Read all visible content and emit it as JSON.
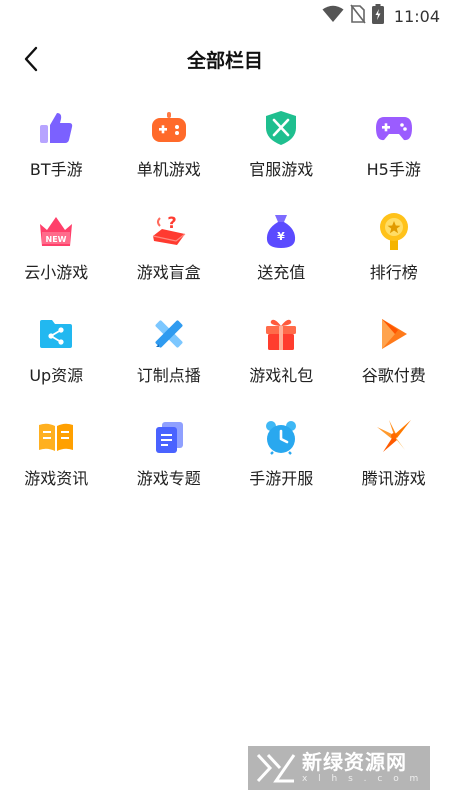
{
  "status_bar": {
    "time": "11:04"
  },
  "header": {
    "title": "全部栏目"
  },
  "categories": [
    {
      "label": "BT手游",
      "icon": "thumbs-up-icon"
    },
    {
      "label": "单机游戏",
      "icon": "gamepad-icon"
    },
    {
      "label": "官服游戏",
      "icon": "shield-swords-icon"
    },
    {
      "label": "H5手游",
      "icon": "controller-icon"
    },
    {
      "label": "云小游戏",
      "icon": "new-crown-icon"
    },
    {
      "label": "游戏盲盒",
      "icon": "mystery-box-icon"
    },
    {
      "label": "送充值",
      "icon": "money-bag-icon"
    },
    {
      "label": "排行榜",
      "icon": "medal-icon"
    },
    {
      "label": "Up资源",
      "icon": "share-folder-icon"
    },
    {
      "label": "订制点播",
      "icon": "pencil-ruler-icon"
    },
    {
      "label": "游戏礼包",
      "icon": "gift-icon"
    },
    {
      "label": "谷歌付费",
      "icon": "play-store-icon"
    },
    {
      "label": "游戏资讯",
      "icon": "open-book-icon"
    },
    {
      "label": "游戏专题",
      "icon": "documents-icon"
    },
    {
      "label": "手游开服",
      "icon": "alarm-clock-icon"
    },
    {
      "label": "腾讯游戏",
      "icon": "tencent-game-icon"
    }
  ],
  "watermark": {
    "brand_cn": "新绿资源网",
    "brand_en": "x l h s . c o m"
  }
}
